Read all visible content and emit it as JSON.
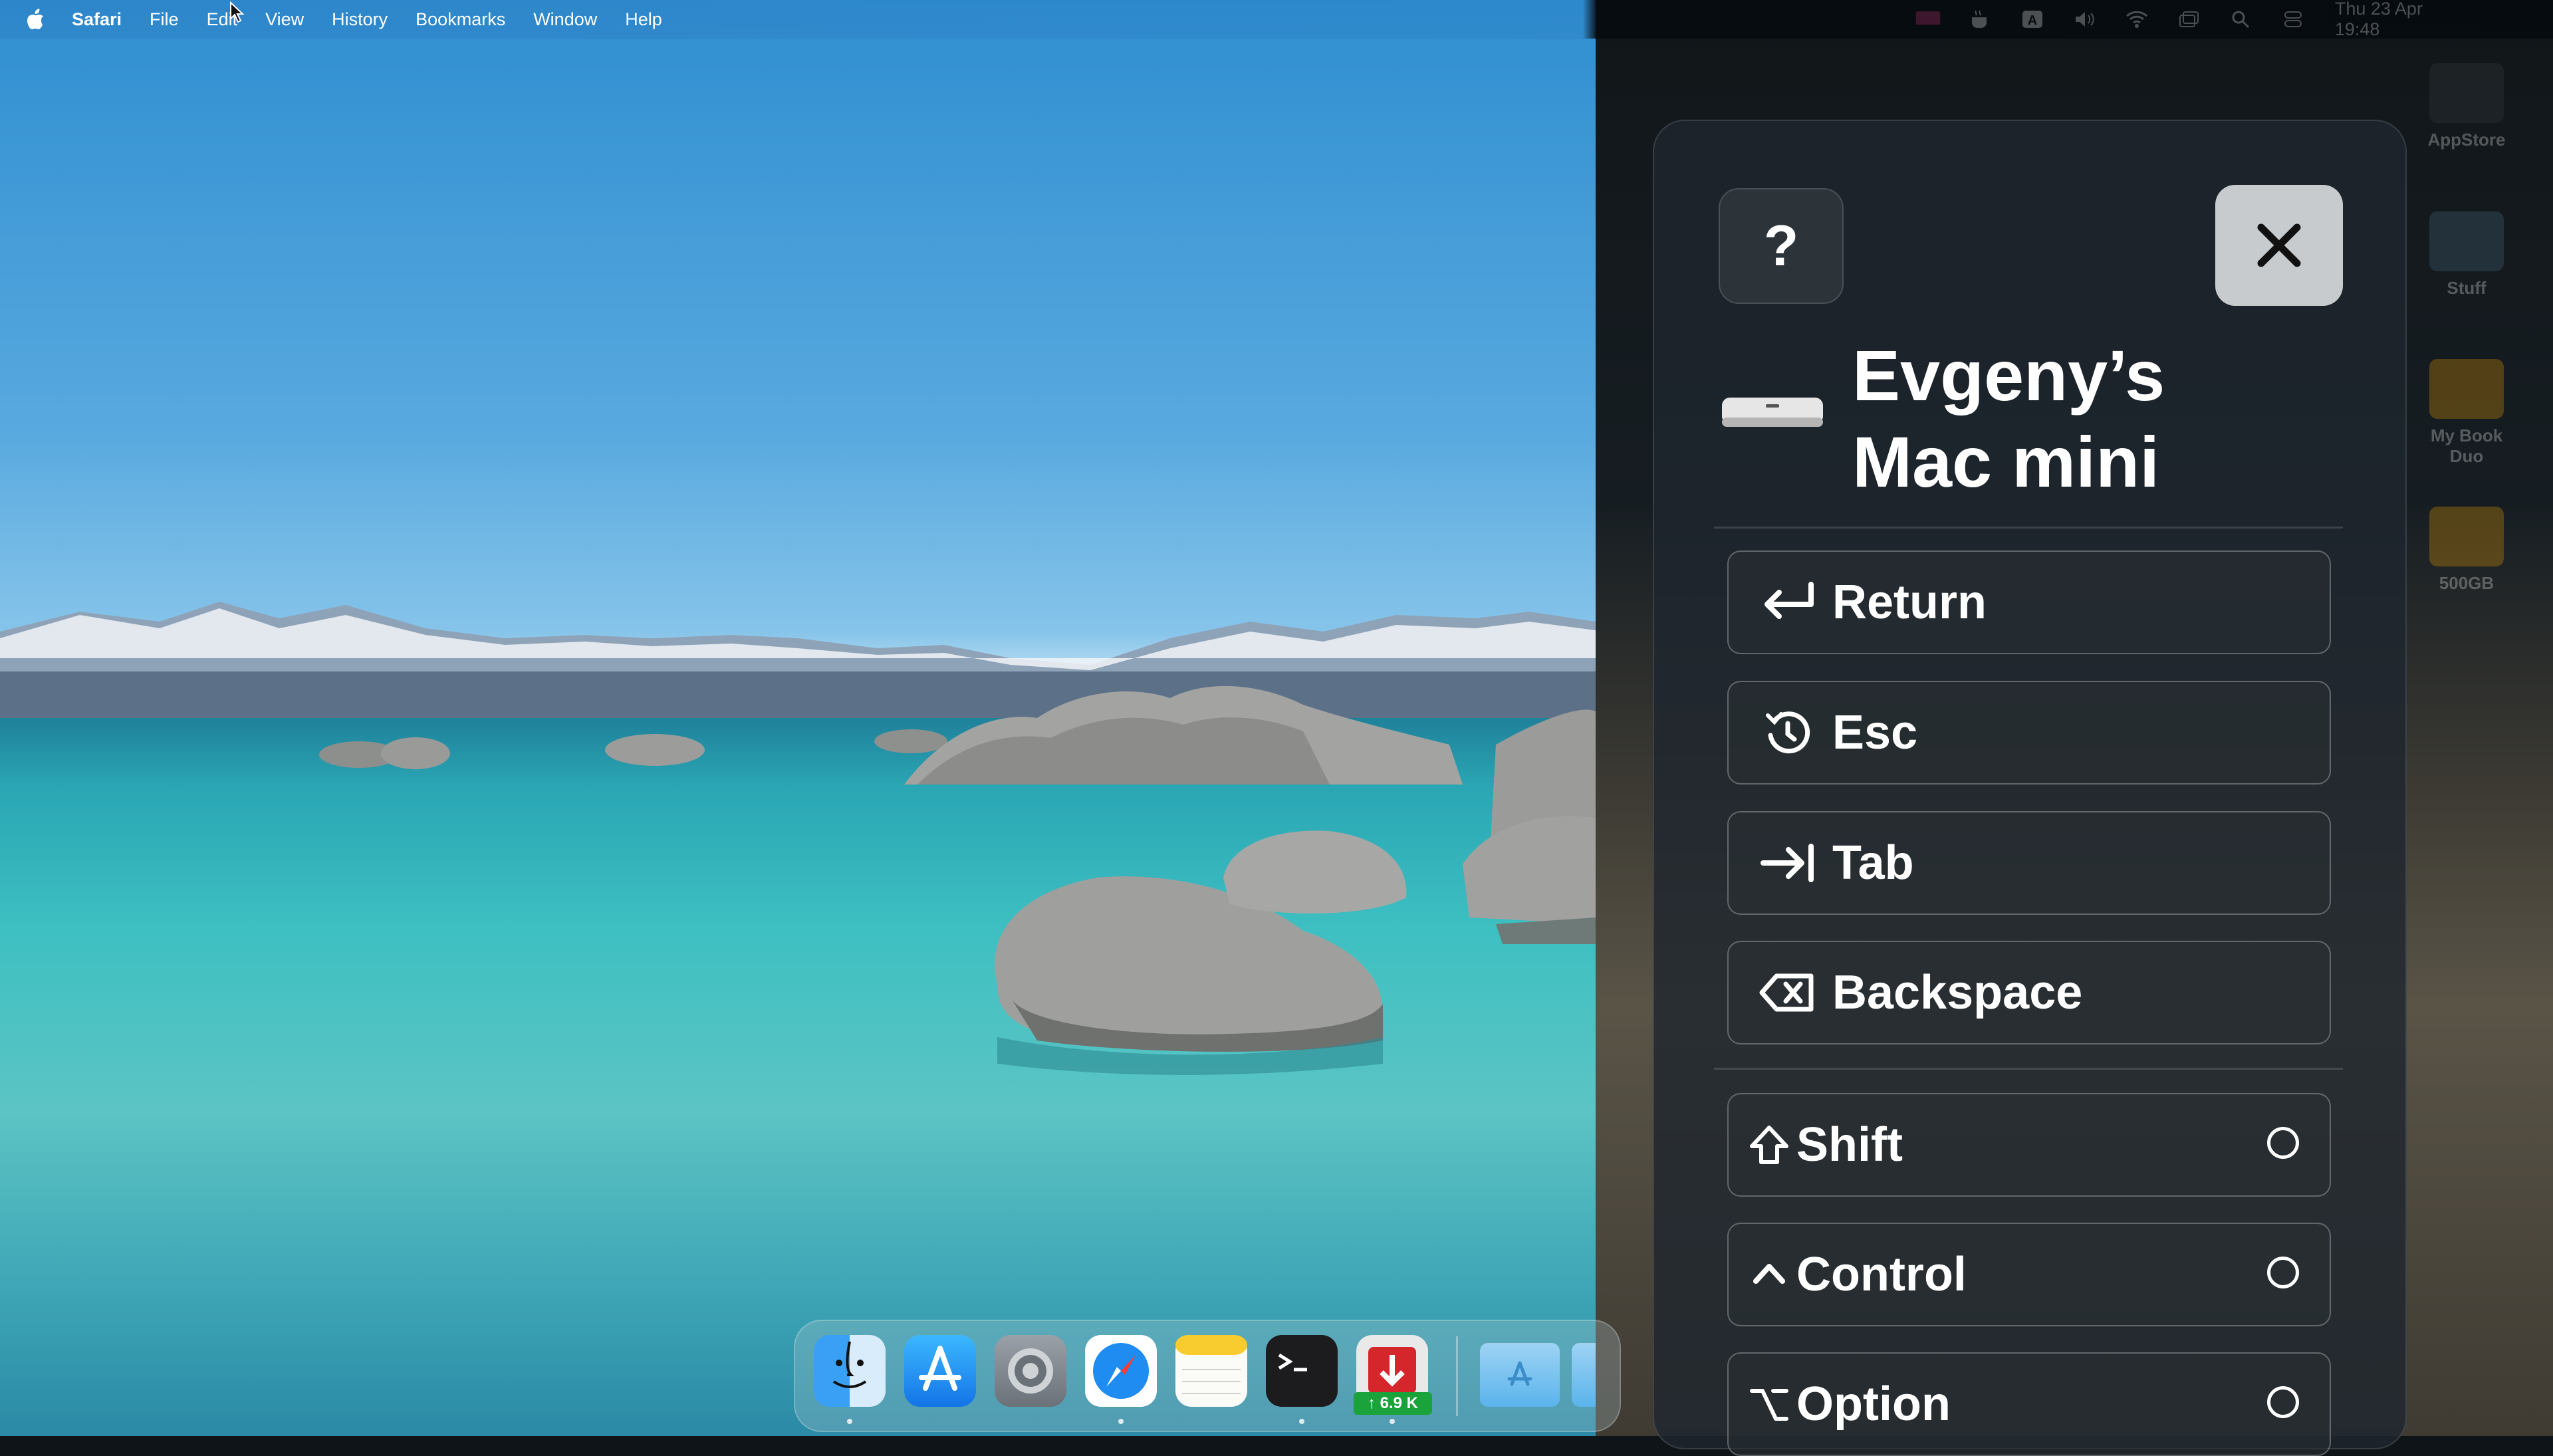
{
  "menubar": {
    "app_name": "Safari",
    "items": [
      "File",
      "Edit",
      "View",
      "History",
      "Bookmarks",
      "Window",
      "Help"
    ],
    "clock": "Thu 23 Apr  19:48"
  },
  "desktop_icons": [
    {
      "label": "AppStore",
      "color": "#3a3f44"
    },
    {
      "label": "Stuff",
      "color": "#4a6f87"
    },
    {
      "label": "My Book Duo",
      "color": "#f4a300"
    },
    {
      "label": "500GB",
      "color": "#f4a300"
    }
  ],
  "panel": {
    "help_label": "?",
    "device_name_line1": "Evgeny’s",
    "device_name_line2": "Mac mini",
    "keys": [
      {
        "label": "Return",
        "icon": "return-icon"
      },
      {
        "label": "Esc",
        "icon": "escape-icon"
      },
      {
        "label": "Tab",
        "icon": "tab-icon"
      },
      {
        "label": "Backspace",
        "icon": "backspace-icon"
      }
    ],
    "modifiers": [
      {
        "label": "Shift",
        "icon": "shift-icon",
        "selected": false
      },
      {
        "label": "Control",
        "icon": "control-icon",
        "selected": false
      },
      {
        "label": "Option",
        "icon": "option-icon",
        "selected": false
      }
    ]
  },
  "dock": {
    "apps": [
      "finder-icon",
      "app-store-icon",
      "system-settings-icon",
      "safari-icon",
      "notes-icon",
      "terminal-icon",
      "transmit-icon",
      "downloads-folder-icon"
    ],
    "badge": "↑ 6.9 K"
  }
}
